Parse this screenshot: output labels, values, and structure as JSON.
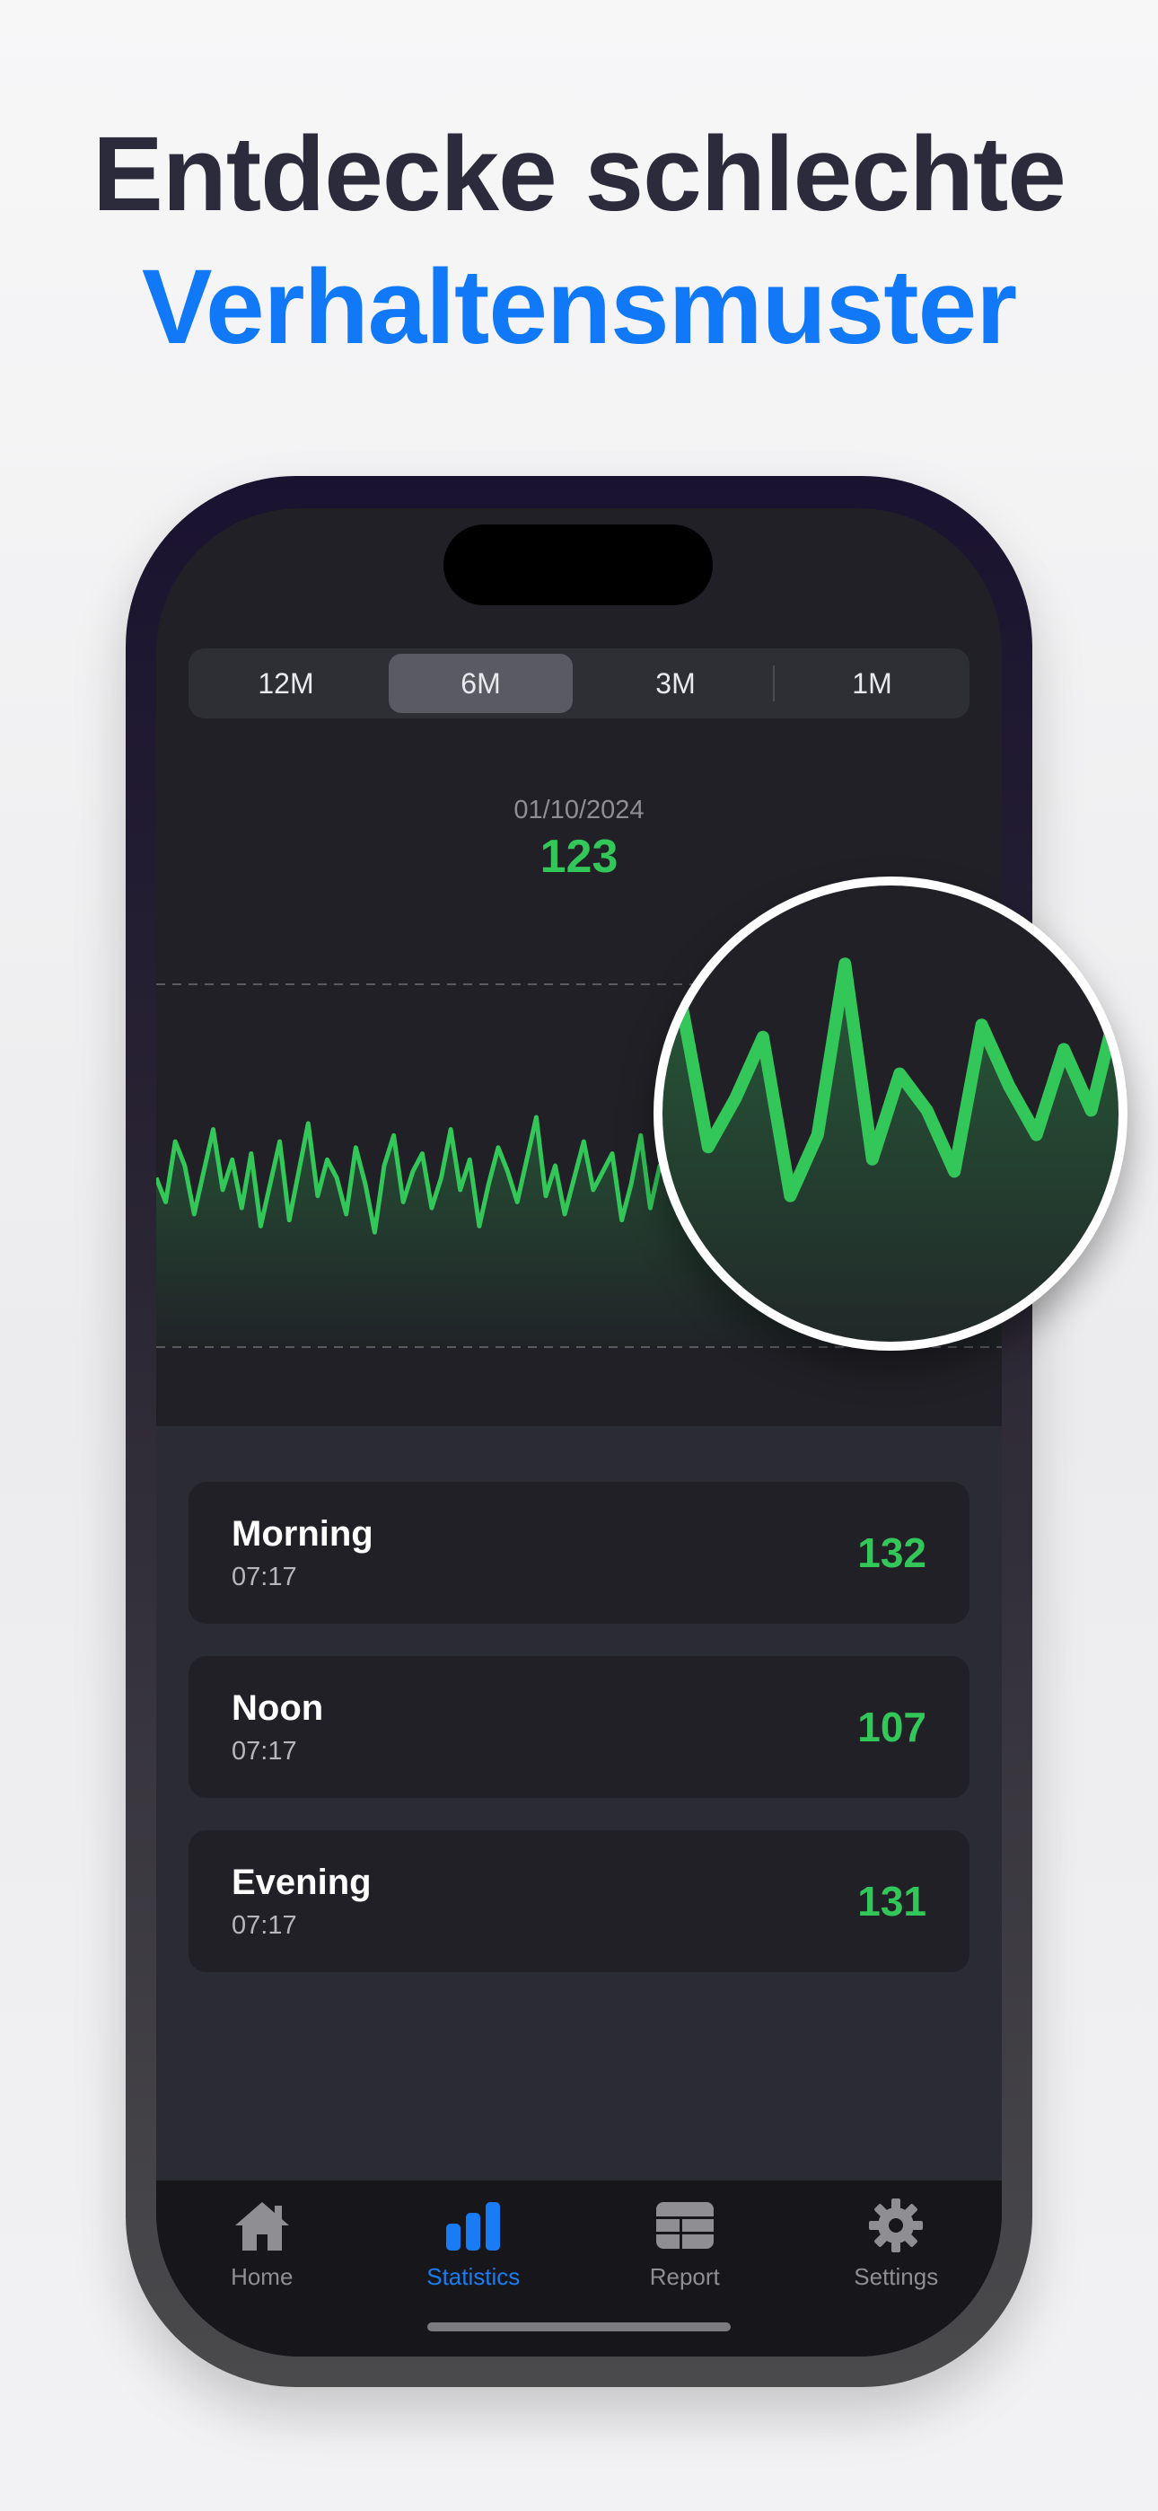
{
  "headline": {
    "line1": "Entdecke schlechte",
    "line2": "Verhaltensmuster"
  },
  "segments": [
    "12M",
    "6M",
    "3M",
    "1M"
  ],
  "selected_segment": "6M",
  "selected": {
    "date": "01/10/2024",
    "value": "123"
  },
  "readings": [
    {
      "label": "Morning",
      "time": "07:17",
      "value": "132"
    },
    {
      "label": "Noon",
      "time": "07:17",
      "value": "107"
    },
    {
      "label": "Evening",
      "time": "07:17",
      "value": "131"
    }
  ],
  "tabs": [
    {
      "label": "Home",
      "icon": "house-icon"
    },
    {
      "label": "Statistics",
      "icon": "bar-chart-icon"
    },
    {
      "label": "Report",
      "icon": "table-icon"
    },
    {
      "label": "Settings",
      "icon": "gear-icon"
    }
  ],
  "active_tab": "Statistics",
  "colors": {
    "accent_blue": "#1179f7",
    "green": "#33c759",
    "dark_text": "#2c2b3c"
  },
  "chart_data": {
    "type": "line",
    "x": [
      1,
      2,
      3,
      4,
      5,
      6,
      7,
      8,
      9,
      10,
      11,
      12,
      13,
      14,
      15,
      16,
      17,
      18,
      19,
      20,
      21,
      22,
      23,
      24,
      25,
      26,
      27,
      28,
      29,
      30,
      31,
      32,
      33,
      34,
      35,
      36,
      37,
      38,
      39,
      40,
      41,
      42,
      43,
      44,
      45,
      46,
      47,
      48,
      49,
      50,
      51,
      52,
      53,
      54,
      55,
      56,
      57,
      58,
      59,
      60,
      61,
      62,
      63,
      64,
      65,
      66,
      67,
      68,
      69,
      70,
      71,
      72,
      73,
      74,
      75,
      76,
      77,
      78,
      79,
      80,
      81,
      82,
      83,
      84,
      85,
      86,
      87,
      88,
      89,
      90
    ],
    "values": [
      118,
      114,
      124,
      120,
      112,
      119,
      126,
      116,
      121,
      113,
      122,
      110,
      117,
      124,
      111,
      119,
      127,
      115,
      121,
      118,
      112,
      123,
      117,
      109,
      120,
      125,
      114,
      119,
      122,
      113,
      118,
      126,
      116,
      121,
      110,
      117,
      123,
      119,
      114,
      121,
      128,
      115,
      120,
      112,
      118,
      124,
      116,
      119,
      122,
      111,
      117,
      125,
      113,
      120,
      118,
      123,
      114,
      121,
      117,
      126,
      112,
      119,
      124,
      116,
      121,
      139,
      118,
      114,
      122,
      120,
      126,
      113,
      124,
      130,
      118,
      122,
      127,
      114,
      119,
      133,
      117,
      124,
      121,
      116,
      128,
      123,
      119,
      126,
      121,
      130
    ],
    "series": [
      {
        "name": "",
        "values": []
      }
    ],
    "title": "",
    "xlabel": "",
    "ylabel": "",
    "ylim": [
      90,
      150
    ]
  }
}
